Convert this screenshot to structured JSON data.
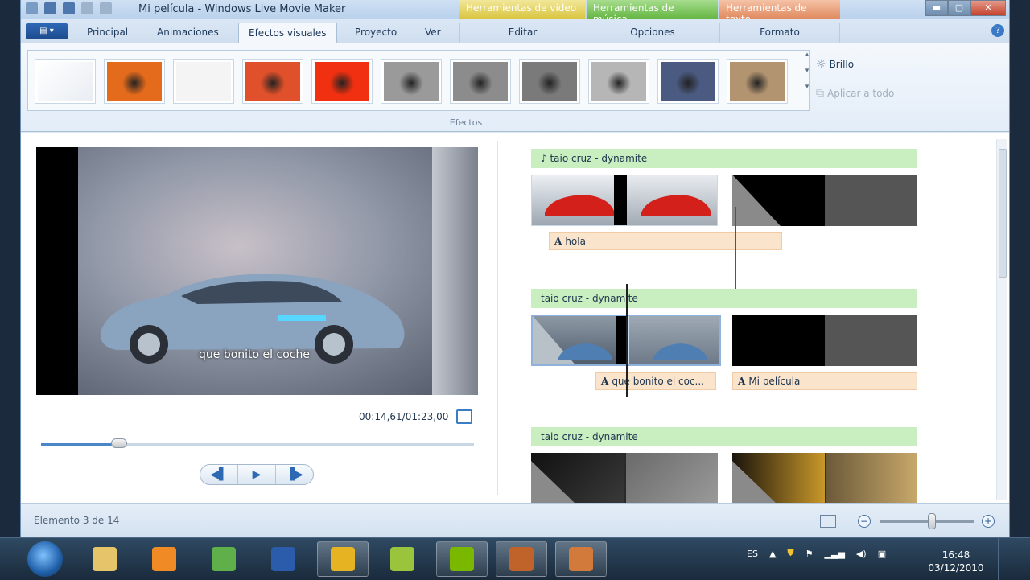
{
  "window": {
    "title": "Mi película - Windows Live Movie Maker",
    "context_tabs": [
      "Herramientas de vídeo",
      "Herramientas de música",
      "Herramientas de texto"
    ],
    "controls": {
      "min": "▬",
      "max": "▢",
      "close": "✕"
    }
  },
  "ribbon": {
    "tabs": [
      "Principal",
      "Animaciones",
      "Efectos visuales",
      "Proyecto",
      "Ver",
      "Editar",
      "Opciones",
      "Formato"
    ],
    "active_tab": "Efectos visuales",
    "group_label": "Efectos",
    "brightness_label": "Brillo",
    "apply_all_label": "Aplicar a todo",
    "effects": [
      {
        "name": "none",
        "color": "#e9eef3"
      },
      {
        "name": "flower-orange",
        "color": "#e46b1c"
      },
      {
        "name": "faded",
        "color": "#f4f4f4"
      },
      {
        "name": "flower-vivid",
        "color": "#e0502a"
      },
      {
        "name": "flower-threshold",
        "color": "#f03010"
      },
      {
        "name": "grayscale-1",
        "color": "#9a9a9a"
      },
      {
        "name": "grayscale-2",
        "color": "#8c8c8c"
      },
      {
        "name": "grayscale-3",
        "color": "#7a7a7a"
      },
      {
        "name": "grayscale-4",
        "color": "#b6b6b6"
      },
      {
        "name": "cyanotype",
        "color": "#4a5a80"
      },
      {
        "name": "sepia",
        "color": "#b39470"
      }
    ]
  },
  "preview": {
    "caption": "que bonito el coche",
    "time": "00:14,61/01:23,00",
    "progress": 0.18,
    "transport": {
      "prev": "◀▌",
      "play": "▶",
      "next": "▐▶"
    }
  },
  "storyboard": {
    "music_label": "taio cruz - dynamite",
    "rows": [
      {
        "music": "♪ taio cruz - dynamite",
        "text1": "hola",
        "text2": ""
      },
      {
        "music": "taio cruz - dynamite",
        "text1": "que bonito el coc...",
        "text2": "Mi película"
      },
      {
        "music": "taio cruz - dynamite",
        "text1": "",
        "text2": ""
      }
    ]
  },
  "status": {
    "element": "Elemento 3 de 14",
    "zoom_minus": "−",
    "zoom_plus": "+",
    "zoom_level": 0.55
  },
  "taskbar": {
    "lang": "ES",
    "time": "16:48",
    "date": "03/12/2010",
    "apps": [
      {
        "name": "explorer",
        "color": "#e6c46a",
        "open": false
      },
      {
        "name": "media-player",
        "color": "#f08a24",
        "open": false
      },
      {
        "name": "messenger",
        "color": "#5fb04a",
        "open": false
      },
      {
        "name": "word",
        "color": "#2a5cab",
        "open": false
      },
      {
        "name": "chrome",
        "color": "#e6b422",
        "open": true
      },
      {
        "name": "security-egg",
        "color": "#9ac43c",
        "open": false
      },
      {
        "name": "spotify",
        "color": "#7ab800",
        "open": true
      },
      {
        "name": "glove-app",
        "color": "#c0632a",
        "open": true
      },
      {
        "name": "movie-maker",
        "color": "#d27a3c",
        "open": true
      }
    ]
  }
}
